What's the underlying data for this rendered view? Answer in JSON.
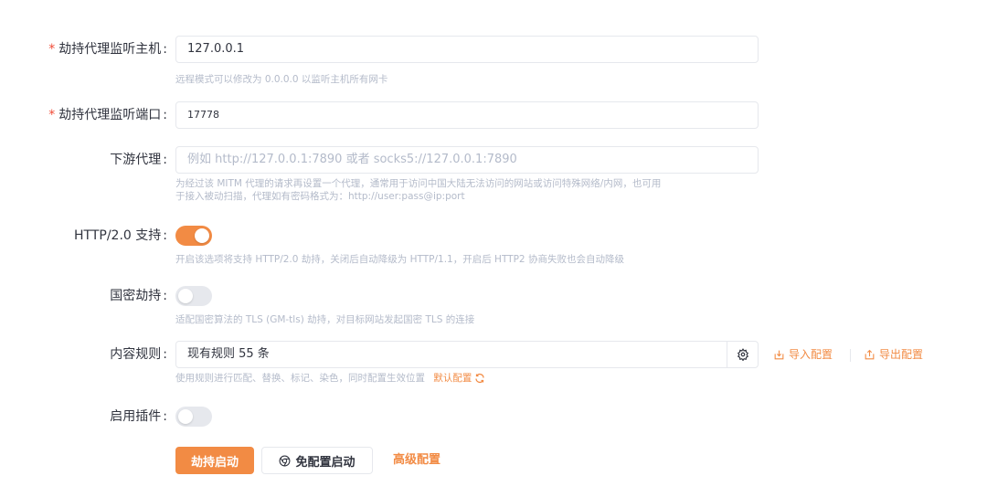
{
  "form": {
    "host": {
      "label": "劫持代理监听主机",
      "required": "*",
      "value": "127.0.0.1",
      "help": "远程模式可以修改为 0.0.0.0 以监听主机所有网卡"
    },
    "port": {
      "label": "劫持代理监听端口",
      "required": "*",
      "value": "17778"
    },
    "downstream": {
      "label": "下游代理",
      "placeholder": "例如 http://127.0.0.1:7890 或者 socks5://127.0.0.1:7890",
      "help_line1": "为经过该 MITM 代理的请求再设置一个代理，通常用于访问中国大陆无法访问的网站或访问特殊网络/内网，也可用",
      "help_line2": "于接入被动扫描，代理如有密码格式为：http://user:pass@ip:port"
    },
    "http2": {
      "label": "HTTP/2.0 支持",
      "enabled": true,
      "help": "开启该选项将支持 HTTP/2.0 劫持，关闭后自动降级为 HTTP/1.1，开启后 HTTP2 协商失败也会自动降级"
    },
    "gm": {
      "label": "国密劫持",
      "enabled": false,
      "help": "适配国密算法的 TLS (GM-tls) 劫持，对目标网站发起国密 TLS 的连接"
    },
    "rules": {
      "label": "内容规则",
      "value": "现有规则 55 条",
      "import_label": "导入配置",
      "export_label": "导出配置",
      "help": "使用规则进行匹配、替换、标记、染色，同时配置生效位置",
      "default_label": "默认配置"
    },
    "plugins": {
      "label": "启用插件",
      "enabled": false
    }
  },
  "actions": {
    "start_label": "劫持启动",
    "no_config_label": "免配置启动",
    "advanced_label": "高级配置"
  },
  "colors": {
    "accent": "#f28b44",
    "required": "#f04b37",
    "help_text": "#b4bbca",
    "border": "#e6e8ed"
  }
}
